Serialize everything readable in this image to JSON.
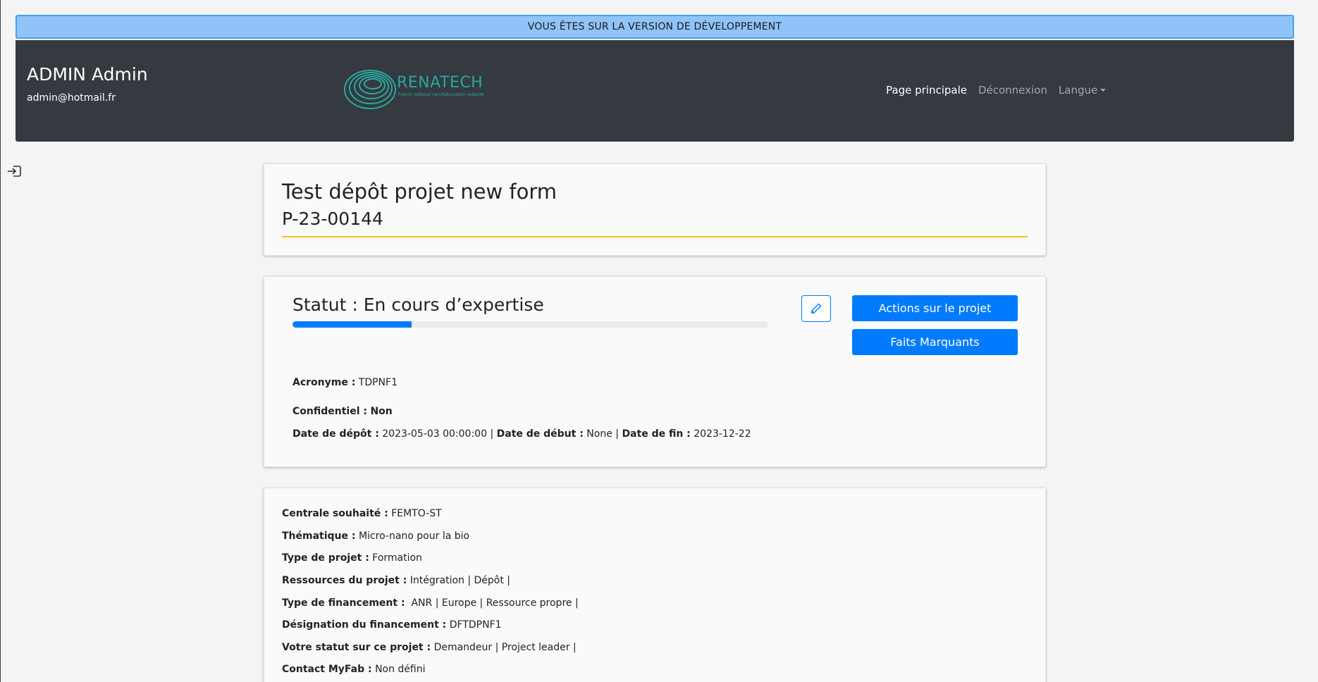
{
  "dev_banner": "VOUS ÊTES SUR LA VERSION DE DÉVELOPPEMENT",
  "user": {
    "name": "ADMIN Admin",
    "email": "admin@hotmail.fr"
  },
  "logo": {
    "text": "RENATECH",
    "subtitle": "French national nanofabrication network"
  },
  "nav": {
    "home": "Page principale",
    "logout": "Déconnexion",
    "language": "Langue"
  },
  "project": {
    "title": "Test dépôt projet new form",
    "id": "P-23-00144"
  },
  "status": {
    "label": "Statut : En cours d’expertise",
    "progress_percent": 25,
    "actions_button": "Actions sur le projet",
    "highlights_button": "Faits Marquants"
  },
  "summary": {
    "acronym_label": "Acronyme :",
    "acronym_value": "TDPNF1",
    "confidential_label": "Confidentiel :",
    "confidential_value": "Non",
    "deposit_label": "Date de dépôt :",
    "deposit_value": "2023-05-03 00:00:00",
    "start_label": "Date de début :",
    "start_value": "None",
    "end_label": "Date de fin :",
    "end_value": "2023-12-22",
    "separator": "|"
  },
  "details": [
    {
      "label": "Centrale souhaité :",
      "value": "FEMTO-ST"
    },
    {
      "label": "Thématique :",
      "value": "Micro-nano pour la bio"
    },
    {
      "label": "Type de projet :",
      "value": "Formation"
    },
    {
      "label": "Ressources du projet :",
      "value": "Intégration | Dépôt |"
    },
    {
      "label": "Type de financement :",
      "value": " ANR | Europe | Ressource propre |"
    },
    {
      "label": "Désignation du financement :",
      "value": "DFTDPNF1"
    },
    {
      "label": "Votre statut sur ce projet :",
      "value": "Demandeur | Project leader |"
    },
    {
      "label": "Contact MyFab :",
      "value": "Non défini"
    }
  ],
  "colors": {
    "banner": "#90c4f9",
    "navbar": "#343a40",
    "primary": "#007bff",
    "accent_line": "#f0c419",
    "logo": "#28a7a0"
  }
}
